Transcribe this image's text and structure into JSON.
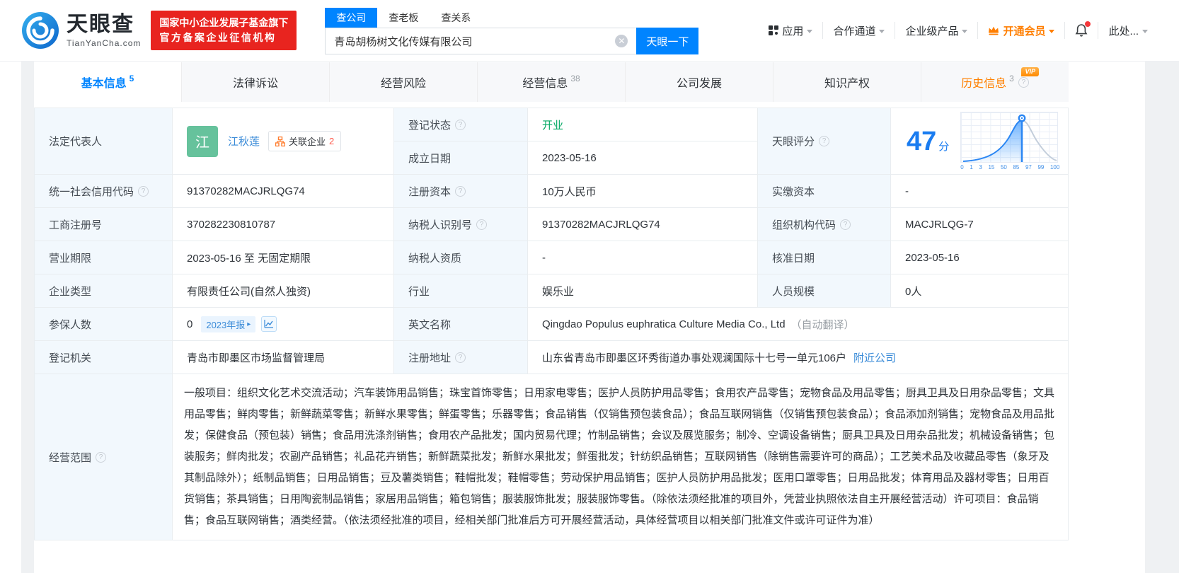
{
  "header": {
    "brand": {
      "name": "天眼查",
      "domain": "TianYanCha.com"
    },
    "cert": {
      "line1": "国家中小企业发展子基金旗下",
      "line2": "官方备案企业征信机构"
    },
    "search": {
      "tab_company": "查公司",
      "tab_boss": "查老板",
      "tab_relation": "查关系",
      "value": "青岛胡杨树文化传媒有限公司",
      "button": "天眼一下"
    },
    "nav": {
      "apps": "应用",
      "partner": "合作通道",
      "enterprise": "企业级产品",
      "vip": "开通会员",
      "more": "此处..."
    }
  },
  "tabs": [
    {
      "label": "基本信息",
      "count": "5"
    },
    {
      "label": "法律诉讼",
      "count": ""
    },
    {
      "label": "经营风险",
      "count": ""
    },
    {
      "label": "经营信息",
      "count": "38"
    },
    {
      "label": "公司发展",
      "count": ""
    },
    {
      "label": "知识产权",
      "count": ""
    },
    {
      "label": "历史信息",
      "count": "3",
      "vip": "VIP"
    }
  ],
  "fields": {
    "legal_rep": {
      "label": "法定代表人",
      "avatar": "江",
      "name": "江秋莲",
      "related": "关联企业",
      "related_count": "2"
    },
    "reg_status": {
      "label": "登记状态",
      "value": "开业"
    },
    "establish_date": {
      "label": "成立日期",
      "value": "2023-05-16"
    },
    "score": {
      "label": "天眼评分",
      "value": "47",
      "unit": "分",
      "axis_ticks": [
        "0",
        "1",
        "3",
        "15",
        "50",
        "85",
        "97",
        "99",
        "100"
      ]
    },
    "credit_code": {
      "label": "统一社会信用代码",
      "value": "91370282MACJRLQG74"
    },
    "reg_capital": {
      "label": "注册资本",
      "value": "10万人民币"
    },
    "paid_capital": {
      "label": "实缴资本",
      "value": "-"
    },
    "reg_number": {
      "label": "工商注册号",
      "value": "370282230810787"
    },
    "taxpayer_id": {
      "label": "纳税人识别号",
      "value": "91370282MACJRLQG74"
    },
    "org_code": {
      "label": "组织机构代码",
      "value": "MACJRLQG-7"
    },
    "term": {
      "label": "营业期限",
      "value": "2023-05-16 至 无固定期限"
    },
    "taxpayer_qual": {
      "label": "纳税人资质",
      "value": "-"
    },
    "approval_date": {
      "label": "核准日期",
      "value": "2023-05-16"
    },
    "company_type": {
      "label": "企业类型",
      "value": "有限责任公司(自然人独资)"
    },
    "industry": {
      "label": "行业",
      "value": "娱乐业"
    },
    "staff_size": {
      "label": "人员规模",
      "value": "0人"
    },
    "insured": {
      "label": "参保人数",
      "value": "0",
      "report_badge": "2023年报"
    },
    "english_name": {
      "label": "英文名称",
      "value": "Qingdao Populus euphratica Culture Media Co., Ltd",
      "note": "（自动翻译）"
    },
    "registry": {
      "label": "登记机关",
      "value": "青岛市即墨区市场监督管理局"
    },
    "address": {
      "label": "注册地址",
      "value": "山东省青岛市即墨区环秀街道办事处观澜国际十七号一单元106户",
      "link": "附近公司"
    },
    "scope": {
      "label": "经营范围",
      "value": "一般项目：组织文化艺术交流活动；汽车装饰用品销售；珠宝首饰零售；日用家电零售；医护人员防护用品零售；食用农产品零售；宠物食品及用品零售；厨具卫具及日用杂品零售；文具用品零售；鲜肉零售；新鲜蔬菜零售；新鲜水果零售；鲜蛋零售；乐器零售；食品销售（仅销售预包装食品）；食品互联网销售（仅销售预包装食品）；食品添加剂销售；宠物食品及用品批发；保健食品（预包装）销售；食品用洗涤剂销售；食用农产品批发；国内贸易代理；竹制品销售；会议及展览服务；制冷、空调设备销售；厨具卫具及日用杂品批发；机械设备销售；包装服务；鲜肉批发；农副产品销售；礼品花卉销售；新鲜蔬菜批发；新鲜水果批发；鲜蛋批发；针纺织品销售；互联网销售（除销售需要许可的商品）；工艺美术品及收藏品零售（象牙及其制品除外）；纸制品销售；日用品销售；豆及薯类销售；鞋帽批发；鞋帽零售；劳动保护用品销售；医护人员防护用品批发；医用口罩零售；日用品批发；体育用品及器材零售；日用百货销售；茶具销售；日用陶瓷制品销售；家居用品销售；箱包销售；服装服饰批发；服装服饰零售。（除依法须经批准的项目外，凭营业执照依法自主开展经营活动）许可项目：食品销售；食品互联网销售；酒类经营。（依法须经批准的项目，经相关部门批准后方可开展经营活动，具体经营项目以相关部门批准文件或许可证件为准）"
    }
  }
}
